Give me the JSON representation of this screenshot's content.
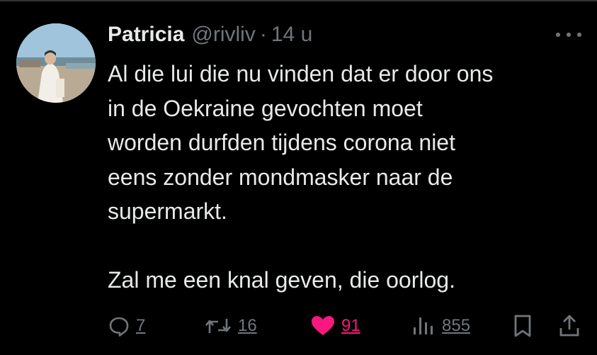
{
  "tweet": {
    "author_name": "Patricia",
    "handle": "@rivliv",
    "separator": "·",
    "time": "14 u",
    "text": "Al die lui die nu vinden dat er door ons\nin de Oekraine gevochten moet\nworden durfden tijdens corona niet\neens zonder mondmasker naar de\nsupermarkt.\n\nZal me een knal geven, die oorlog.",
    "replies": "7",
    "reposts": "16",
    "likes": "91",
    "views": "855"
  },
  "colors": {
    "background": "#000000",
    "text": "#e7e9ea",
    "muted": "#71767b",
    "like": "#f91880"
  },
  "icons": {
    "more": "more-dots-icon",
    "reply": "reply-bubble-icon",
    "repost": "repost-arrows-icon",
    "like": "heart-filled-icon",
    "views": "views-bars-icon",
    "bookmark": "bookmark-icon",
    "share": "share-upload-icon"
  }
}
